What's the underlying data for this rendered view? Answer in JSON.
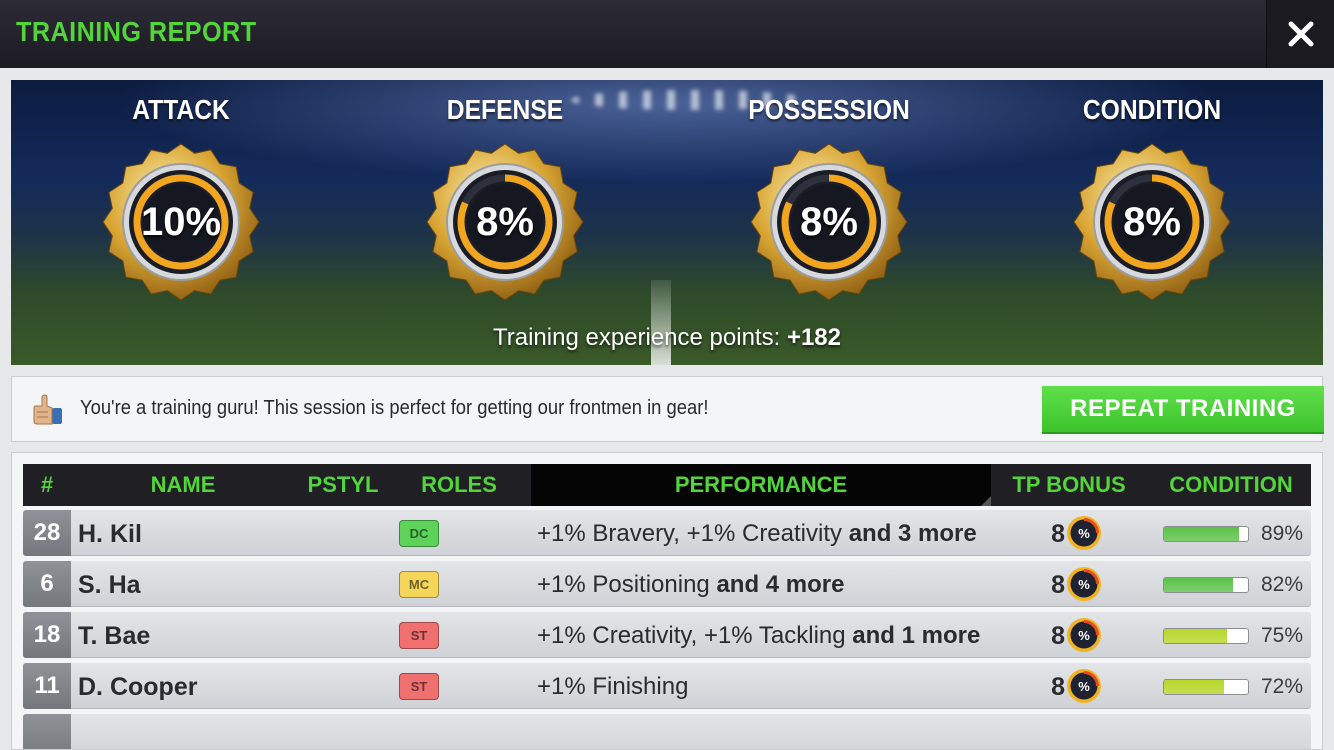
{
  "header": {
    "title": "TRAINING REPORT"
  },
  "stats": [
    {
      "label": "ATTACK",
      "value": "10%",
      "progress": 0.1
    },
    {
      "label": "DEFENSE",
      "value": "8%",
      "progress": 0.08
    },
    {
      "label": "POSSESSION",
      "value": "8%",
      "progress": 0.08
    },
    {
      "label": "CONDITION",
      "value": "8%",
      "progress": 0.08
    }
  ],
  "xp": {
    "label": "Training experience points:",
    "value": "+182"
  },
  "message": {
    "text": "You're a training guru! This session is perfect for getting our frontmen in gear!",
    "button_label": "REPEAT TRAINING"
  },
  "table": {
    "headers": {
      "num": "#",
      "name": "NAME",
      "pstyl": "PSTYL",
      "roles": "ROLES",
      "performance": "PERFORMANCE",
      "tp_bonus": "TP BONUS",
      "condition": "CONDITION"
    },
    "rows": [
      {
        "num": "28",
        "name": "H. Kil",
        "role": "DC",
        "role_color": "#5ed35a",
        "perf_plain": "+1% Bravery, +1% Creativity",
        "perf_more": "and 3 more",
        "tp": "8",
        "condition": "89%",
        "condition_level": 0.89,
        "bar_color": "#5cc24a"
      },
      {
        "num": "6",
        "name": "S. Ha",
        "role": "MC",
        "role_color": "#f5d65a",
        "perf_plain": "+1% Positioning",
        "perf_more": "and 4 more",
        "tp": "8",
        "condition": "82%",
        "condition_level": 0.82,
        "bar_color": "#5cc24a"
      },
      {
        "num": "18",
        "name": "T. Bae",
        "role": "ST",
        "role_color": "#f07070",
        "perf_plain": "+1% Creativity, +1% Tackling",
        "perf_more": "and 1 more",
        "tp": "8",
        "condition": "75%",
        "condition_level": 0.75,
        "bar_color": "#b6d72a"
      },
      {
        "num": "11",
        "name": "D. Cooper",
        "role": "ST",
        "role_color": "#f07070",
        "perf_plain": "+1% Finishing",
        "perf_more": "",
        "tp": "8",
        "condition": "72%",
        "condition_level": 0.72,
        "bar_color": "#b6d72a"
      }
    ]
  },
  "icons": {
    "close": "close-icon",
    "thumb": "thumbs-up-icon",
    "tp": "percent-gauge-icon"
  }
}
